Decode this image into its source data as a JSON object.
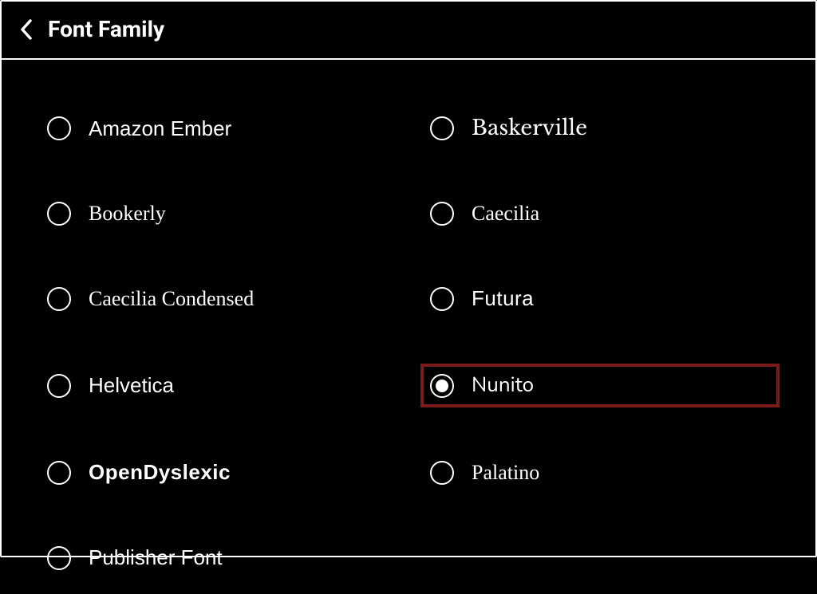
{
  "header": {
    "title": "Font Family"
  },
  "fonts": {
    "left": [
      {
        "label": "Amazon Ember",
        "class": "font-amazon-ember",
        "selected": false,
        "highlighted": false
      },
      {
        "label": "Bookerly",
        "class": "font-bookerly",
        "selected": false,
        "highlighted": false
      },
      {
        "label": "Caecilia Condensed",
        "class": "font-caecilia-cond",
        "selected": false,
        "highlighted": false
      },
      {
        "label": "Helvetica",
        "class": "font-helvetica",
        "selected": false,
        "highlighted": false
      },
      {
        "label": "OpenDyslexic",
        "class": "font-opendyslexic",
        "selected": false,
        "highlighted": false
      },
      {
        "label": "Publisher Font",
        "class": "font-publisher",
        "selected": false,
        "highlighted": false
      }
    ],
    "right": [
      {
        "label": "Baskerville",
        "class": "font-baskerville",
        "selected": false,
        "highlighted": false
      },
      {
        "label": "Caecilia",
        "class": "font-caecilia",
        "selected": false,
        "highlighted": false
      },
      {
        "label": "Futura",
        "class": "font-futura",
        "selected": false,
        "highlighted": false
      },
      {
        "label": "Nunito",
        "class": "font-nunito",
        "selected": true,
        "highlighted": true
      },
      {
        "label": "Palatino",
        "class": "font-palatino",
        "selected": false,
        "highlighted": false
      }
    ]
  },
  "colors": {
    "highlight": "#7a1a1a"
  }
}
